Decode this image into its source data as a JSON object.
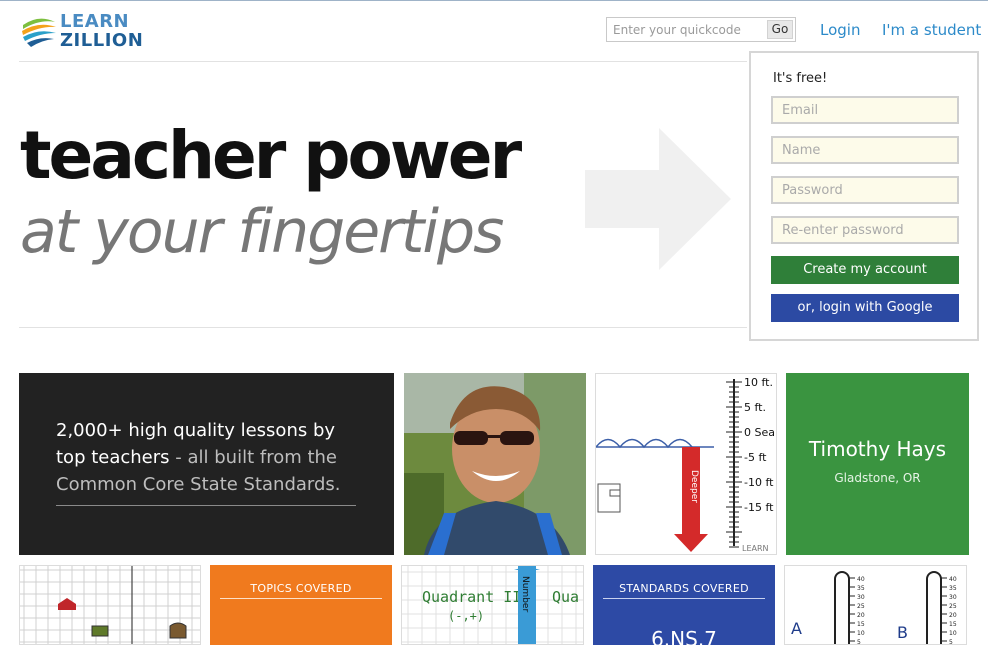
{
  "brand": {
    "line1": "LEARN",
    "line2": "ZILLION"
  },
  "quickcode": {
    "placeholder": "Enter your quickcode",
    "go_label": "Go"
  },
  "nav": {
    "login": "Login",
    "student": "I'm a student"
  },
  "hero": {
    "title": "teacher power",
    "subtitle": "at your fingertips"
  },
  "signup": {
    "heading": "It's free!",
    "email_placeholder": "Email",
    "name_placeholder": "Name",
    "password_placeholder": "Password",
    "reenter_placeholder": "Re-enter password",
    "create_label": "Create my account",
    "google_label": "or, login with Google"
  },
  "tiles": {
    "lessons": {
      "bold": "2,000+ high quality lessons by top teachers",
      "rest": " - all built from the Common Core State Standards."
    },
    "ruler_labels": [
      "10 ft.",
      "5 ft.",
      "0 Sea",
      "-5 ft",
      "-10 ft",
      "-15 ft"
    ],
    "ruler_word": "Deeper",
    "ruler_brand": "LEARN",
    "teacher": {
      "name": "Timothy Hays",
      "location": "Gladstone, OR"
    },
    "topics_heading": "TOPICS COVERED",
    "quadrant_label": "Quadrant II",
    "quadrant_sign": "(-,+)",
    "quadrant_label_right": "Qua",
    "number_word": "Number",
    "standards_heading": "STANDARDS COVERED",
    "standards_code": "6.NS.7",
    "therm_letters": [
      "A",
      "B"
    ],
    "therm_ticks": [
      "40",
      "35",
      "30",
      "25",
      "20",
      "15",
      "10",
      "5"
    ]
  },
  "colors": {
    "link": "#2c8ac9",
    "create_button": "#2f7f39",
    "google_button": "#2c4aa3",
    "dark_tile": "#222222",
    "green_tile": "#3a9440",
    "orange_tile": "#f07a1e",
    "blue_tile": "#2d4aa5"
  }
}
